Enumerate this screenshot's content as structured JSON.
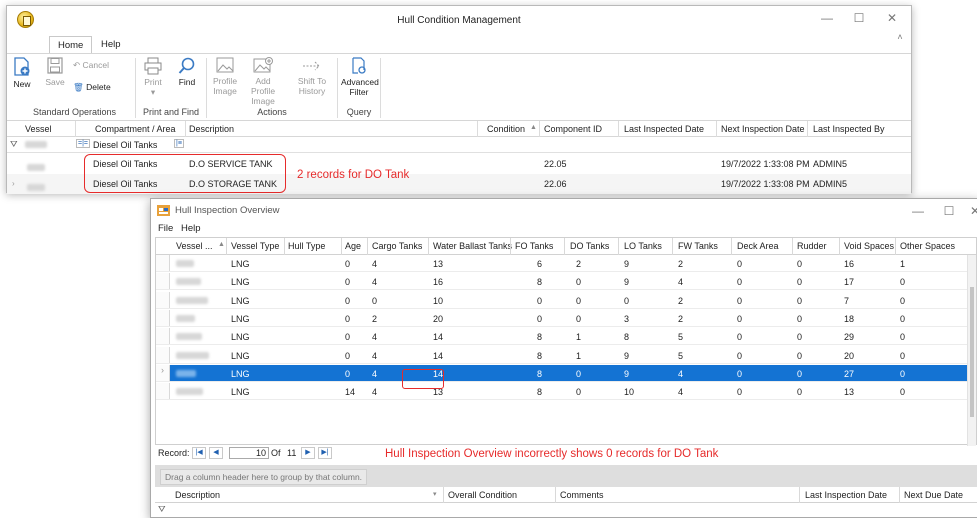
{
  "main_window": {
    "title": "Hull Condition Management",
    "window_controls": {
      "minimize": "—",
      "maximize": "☐",
      "close": "✕"
    },
    "ribbon_tabs": [
      "Home",
      "Help"
    ],
    "ribbon": {
      "groups": [
        {
          "label": "Standard Operations"
        },
        {
          "label": "Print and Find"
        },
        {
          "label": "Actions"
        },
        {
          "label": "Query"
        }
      ],
      "buttons": {
        "new": "New",
        "save": "Save",
        "cancel": "Cancel",
        "delete": "Delete",
        "print": "Print",
        "find": "Find",
        "profile_image": "Profile Image",
        "add_profile_image": "Add Profile Image",
        "shift_to_history": "Shift To History",
        "advanced_filter": "Advanced Filter"
      }
    },
    "grid": {
      "columns": [
        "Vessel",
        "Compartment / Area",
        "Description",
        "Condition",
        "Component ID",
        "Last Inspected Date",
        "Next Inspection Date",
        "Last Inspected By"
      ],
      "filter_value": "Diesel Oil Tanks",
      "rows": [
        {
          "compartment": "Diesel Oil Tanks",
          "description": "D.O SERVICE TANK",
          "component_id": "22.05",
          "next_inspection": "19/7/2022 1:33:08 PM",
          "last_by": "ADMIN5"
        },
        {
          "compartment": "Diesel Oil Tanks",
          "description": "D.O STORAGE TANK",
          "component_id": "22.06",
          "next_inspection": "19/7/2022 1:33:08 PM",
          "last_by": "ADMIN5"
        }
      ]
    },
    "annotation": "2 records for DO Tank"
  },
  "overview_window": {
    "title": "Hull Inspection Overview",
    "window_controls": {
      "minimize": "—",
      "maximize": "☐",
      "close": "✕"
    },
    "menu": [
      "File",
      "Help"
    ],
    "grid": {
      "columns": [
        "Vessel ...",
        "Vessel Type",
        "Hull Type",
        "Age",
        "Cargo Tanks",
        "Water Ballast Tanks",
        "FO Tanks",
        "DO Tanks",
        "LO Tanks",
        "FW Tanks",
        "Deck Area",
        "Rudder",
        "Void Spaces",
        "Other Spaces"
      ],
      "rows": [
        {
          "type": "LNG",
          "age": "0",
          "cargo": "4",
          "wb": "13",
          "fo": "6",
          "do": "2",
          "lo": "9",
          "fw": "2",
          "deck": "0",
          "rudder": "0",
          "void": "16",
          "other": "1"
        },
        {
          "type": "LNG",
          "age": "0",
          "cargo": "4",
          "wb": "16",
          "fo": "8",
          "do": "0",
          "lo": "9",
          "fw": "4",
          "deck": "0",
          "rudder": "0",
          "void": "17",
          "other": "0"
        },
        {
          "type": "LNG",
          "age": "0",
          "cargo": "0",
          "wb": "10",
          "fo": "0",
          "do": "0",
          "lo": "0",
          "fw": "2",
          "deck": "0",
          "rudder": "0",
          "void": "7",
          "other": "0"
        },
        {
          "type": "LNG",
          "age": "0",
          "cargo": "2",
          "wb": "20",
          "fo": "0",
          "do": "0",
          "lo": "3",
          "fw": "2",
          "deck": "0",
          "rudder": "0",
          "void": "18",
          "other": "0"
        },
        {
          "type": "LNG",
          "age": "0",
          "cargo": "4",
          "wb": "14",
          "fo": "8",
          "do": "1",
          "lo": "8",
          "fw": "5",
          "deck": "0",
          "rudder": "0",
          "void": "29",
          "other": "0"
        },
        {
          "type": "LNG",
          "age": "0",
          "cargo": "4",
          "wb": "14",
          "fo": "8",
          "do": "1",
          "lo": "9",
          "fw": "5",
          "deck": "0",
          "rudder": "0",
          "void": "20",
          "other": "0"
        },
        {
          "type": "LNG",
          "age": "0",
          "cargo": "4",
          "wb": "14",
          "fo": "8",
          "do": "0",
          "lo": "9",
          "fw": "4",
          "deck": "0",
          "rudder": "0",
          "void": "27",
          "other": "0",
          "selected": true
        },
        {
          "type": "LNG",
          "age": "14",
          "cargo": "4",
          "wb": "13",
          "fo": "8",
          "do": "0",
          "lo": "10",
          "fw": "4",
          "deck": "0",
          "rudder": "0",
          "void": "13",
          "other": "0"
        }
      ]
    },
    "navigator": {
      "label": "Record:",
      "current": "10",
      "of_label": "Of",
      "total": "11"
    },
    "annotation": "Hull Inspection Overview incorrectly shows 0 records for DO Tank",
    "group_panel_hint": "Drag a column header here to group by that column.",
    "detail_grid": {
      "columns": [
        "Description",
        "Overall Condition",
        "Comments",
        "Last Inspection Date",
        "Next Due Date"
      ]
    }
  },
  "colors": {
    "annotation_red": "#e62b2b",
    "selection_blue": "#1473d3"
  }
}
